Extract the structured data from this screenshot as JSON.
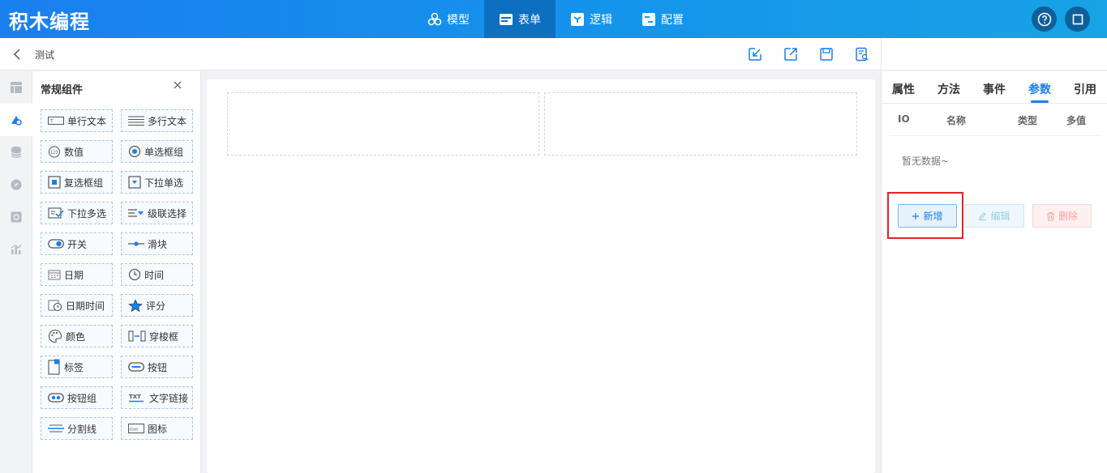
{
  "app": {
    "title": "积木编程"
  },
  "topnav": [
    {
      "label": "模型",
      "icon": "cubes-icon"
    },
    {
      "label": "表单",
      "icon": "form-icon",
      "active": true
    },
    {
      "label": "逻辑",
      "icon": "logic-icon"
    },
    {
      "label": "配置",
      "icon": "config-icon"
    }
  ],
  "breadcrumb": {
    "current": "测试"
  },
  "components_panel": {
    "title": "常规组件",
    "items": [
      "单行文本",
      "多行文本",
      "数值",
      "单选框组",
      "复选框组",
      "下拉单选",
      "下拉多选",
      "级联选择",
      "开关",
      "滑块",
      "日期",
      "时间",
      "日期时间",
      "评分",
      "颜色",
      "穿梭框",
      "标签",
      "按钮",
      "按钮组",
      "文字链接",
      "分割线",
      "图标"
    ]
  },
  "right_panel": {
    "tabs": [
      "属性",
      "方法",
      "事件",
      "参数",
      "引用"
    ],
    "active_tab": "参数",
    "columns": [
      "IO",
      "名称",
      "类型",
      "多值"
    ],
    "empty_text": "暂无数据~",
    "buttons": {
      "add": "新增",
      "edit": "编辑",
      "delete": "删除"
    }
  },
  "colors": {
    "primary": "#1a7ff0",
    "highlight": "#e52323"
  }
}
